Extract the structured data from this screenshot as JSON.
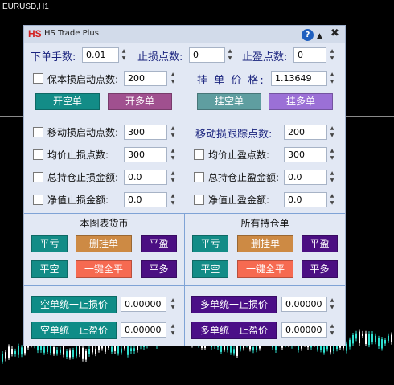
{
  "chart": {
    "title": "EURUSD,H1"
  },
  "panel": {
    "logo": "HS",
    "title": "HS Trade Plus",
    "icons": {
      "help": "?",
      "minimize": "▲",
      "close": "✖"
    }
  },
  "order": {
    "lot_label": "下单手数:",
    "lot_value": "0.01",
    "sl_label": "止损点数:",
    "sl_value": "0",
    "tp_label": "止盈点数:",
    "tp_value": "0",
    "breakeven_label": "保本损启动点数:",
    "breakeven_value": "200",
    "pending_label": "挂 单 价 格:",
    "pending_value": "1.13649",
    "btn_open_sell": "开空单",
    "btn_open_buy": "开多单",
    "btn_pend_sell": "挂空单",
    "btn_pend_buy": "挂多单"
  },
  "risk": {
    "trail_start_label": "移动损启动点数:",
    "trail_start_value": "300",
    "trail_step_label": "移动损跟踪点数:",
    "trail_step_value": "200",
    "avg_sl_label": "均价止损点数:",
    "avg_sl_value": "300",
    "avg_tp_label": "均价止盈点数:",
    "avg_tp_value": "300",
    "total_sl_label": "总持仓止损金额:",
    "total_sl_value": "0.0",
    "total_tp_label": "总持仓止盈金额:",
    "total_tp_value": "0.0",
    "net_sl_label": "净值止损金额:",
    "net_sl_value": "0.0",
    "net_tp_label": "净值止盈金额:",
    "net_tp_value": "0.0"
  },
  "left_section": {
    "title": "本图表货币",
    "btn_close_loss": "平亏",
    "btn_delete_pending": "删挂单",
    "btn_close_profit": "平盈",
    "btn_close_sell": "平空",
    "btn_close_all": "一键全平",
    "btn_close_buy": "平多"
  },
  "right_section": {
    "title": "所有持仓单",
    "btn_close_loss": "平亏",
    "btn_delete_pending": "删挂单",
    "btn_close_profit": "平盈",
    "btn_close_sell": "平空",
    "btn_close_all": "一键全平",
    "btn_close_buy": "平多"
  },
  "unify": {
    "sell_sl_label": "空单统一止损价",
    "sell_sl_value": "0.00000",
    "sell_tp_label": "空单统一止盈价",
    "sell_tp_value": "0.00000",
    "buy_sl_label": "多单统一止损价",
    "buy_sl_value": "0.00000",
    "buy_tp_label": "多单统一止盈价",
    "buy_tp_value": "0.00000"
  },
  "colors": {
    "teal": "#138c87",
    "pink": "#a0508f",
    "slate_teal": "#5f9ea0",
    "lavender": "#9b70d6",
    "tan": "#cd8a44",
    "coral": "#f66a51",
    "indigo": "#4b0f82",
    "sell_teal": "#0f8c87",
    "buy_purple": "#4b0f87"
  }
}
